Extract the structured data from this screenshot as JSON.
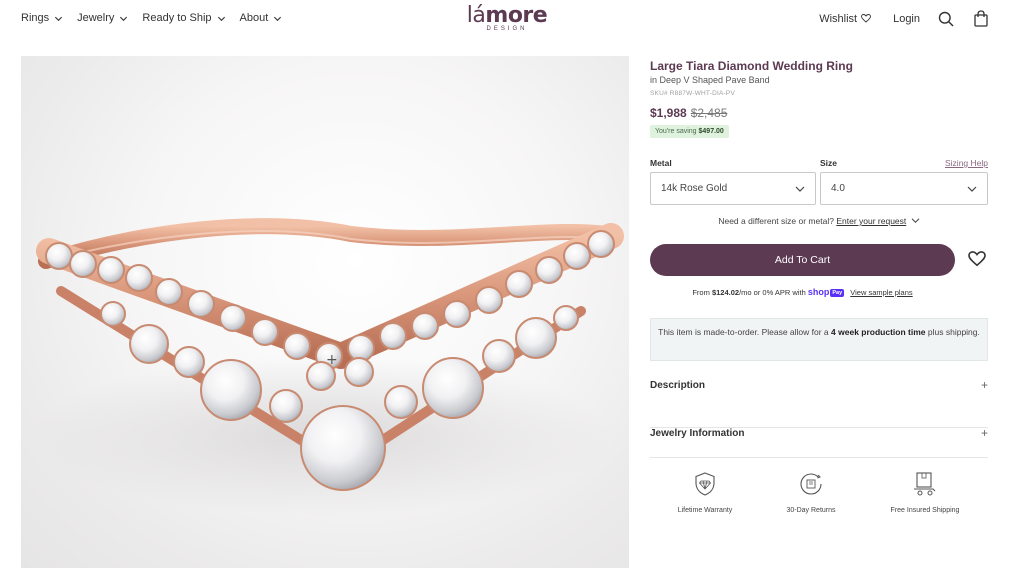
{
  "header": {
    "nav": [
      {
        "label": "Rings"
      },
      {
        "label": "Jewelry"
      },
      {
        "label": "Ready to Ship"
      },
      {
        "label": "About"
      }
    ],
    "logo": {
      "la": "lá",
      "more": "more",
      "sub": "DESIGN"
    },
    "wishlist_label": "Wishlist",
    "login_label": "Login"
  },
  "product": {
    "title": "Large Tiara Diamond Wedding Ring",
    "subtitle": "in Deep V Shaped Pave Band",
    "sku": "SKU# R887W-WHT-DIA-PV",
    "price": "$1,988",
    "old_price": "$2,485",
    "saving_prefix": "You're saving",
    "saving_amount": "$497.00"
  },
  "selectors": {
    "metal_label": "Metal",
    "size_label": "Size",
    "sizing_help": "Sizing Help",
    "metal_value": "14k Rose Gold",
    "size_value": "4.0"
  },
  "request": {
    "text": "Need a different size or metal?",
    "link": "Enter your request"
  },
  "cart": {
    "add_label": "Add To Cart"
  },
  "financing": {
    "prefix": "From",
    "amount": "$124.02",
    "mid": "/mo or 0% APR with",
    "shop": "shop",
    "pay": "Pay",
    "link": "View sample plans"
  },
  "notice": {
    "pre": "This item is made-to-order. Please allow for a",
    "bold": "4 week production time",
    "post": "plus shipping."
  },
  "accordions": [
    {
      "label": "Description",
      "icon": "+"
    },
    {
      "label": "Jewelry Information",
      "icon": "+"
    }
  ],
  "features": [
    {
      "label": "Lifetime Warranty",
      "icon": "diamond-shield-icon"
    },
    {
      "label": "30-Day Returns",
      "icon": "returns-icon"
    },
    {
      "label": "Free Insured Shipping",
      "icon": "shipping-box-icon"
    }
  ],
  "colors": {
    "brand": "#5b3a52",
    "saving_bg": "#dff2de",
    "notice_bg": "#f0f4f4",
    "rose_gold": "#d9967a"
  }
}
